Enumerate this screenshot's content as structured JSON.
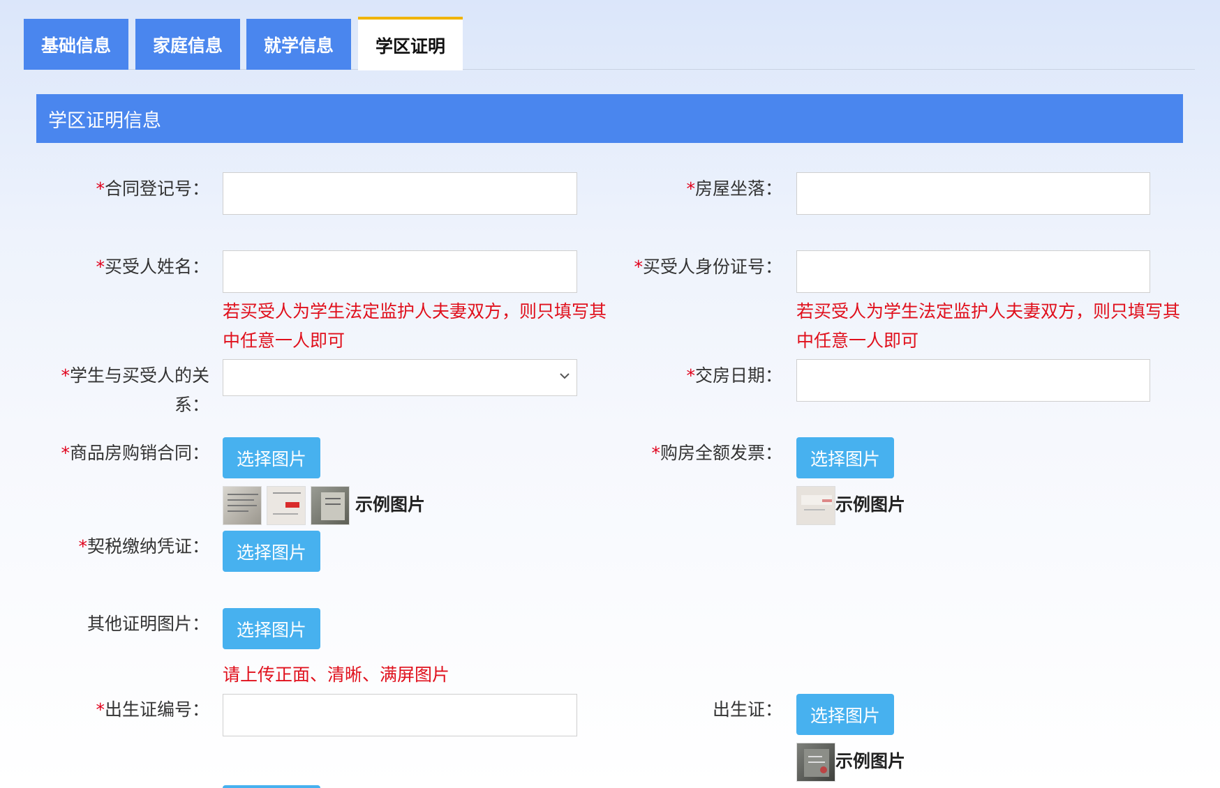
{
  "tabs": [
    {
      "label": "基础信息"
    },
    {
      "label": "家庭信息"
    },
    {
      "label": "就学信息"
    },
    {
      "label": "学区证明",
      "active": true
    }
  ],
  "section": {
    "title": "学区证明信息"
  },
  "fields": {
    "contract_no": {
      "label": "合同登记号：",
      "required": true,
      "value": ""
    },
    "house_location": {
      "label": "房屋坐落：",
      "required": true,
      "value": ""
    },
    "buyer_name": {
      "label": "买受人姓名：",
      "required": true,
      "value": ""
    },
    "buyer_id": {
      "label": "买受人身份证号：",
      "required": true,
      "value": ""
    },
    "buyer_hint_line1": "若买受人为学生法定监护人夫妻双方，则只填写其",
    "buyer_hint_line2": "中任意一人即可",
    "relation": {
      "label_line1": "学生与买受人的关",
      "label_line2": "系：",
      "required": true,
      "selected": ""
    },
    "delivery_date": {
      "label": "交房日期：",
      "required": true,
      "value": ""
    },
    "sales_contract": {
      "label": "商品房购销合同：",
      "required": true
    },
    "invoice": {
      "label": "购房全额发票：",
      "required": true
    },
    "tax_voucher": {
      "label": "契税缴纳凭证：",
      "required": true
    },
    "other_proof": {
      "label": "其他证明图片：",
      "required": false
    },
    "upload_hint": "请上传正面、清晰、满屏图片",
    "birth_cert_no": {
      "label": "出生证编号：",
      "required": true,
      "value": ""
    },
    "birth_cert": {
      "label": "出生证：",
      "required": false
    }
  },
  "buttons": {
    "choose_image": "选择图片"
  },
  "example_label": "示例图片",
  "required_mark": "*",
  "colors": {
    "tab_blue": "#4a86ee",
    "button_blue": "#47b1ef",
    "required_red": "#e0001b",
    "active_tab_accent": "#f0b400"
  }
}
